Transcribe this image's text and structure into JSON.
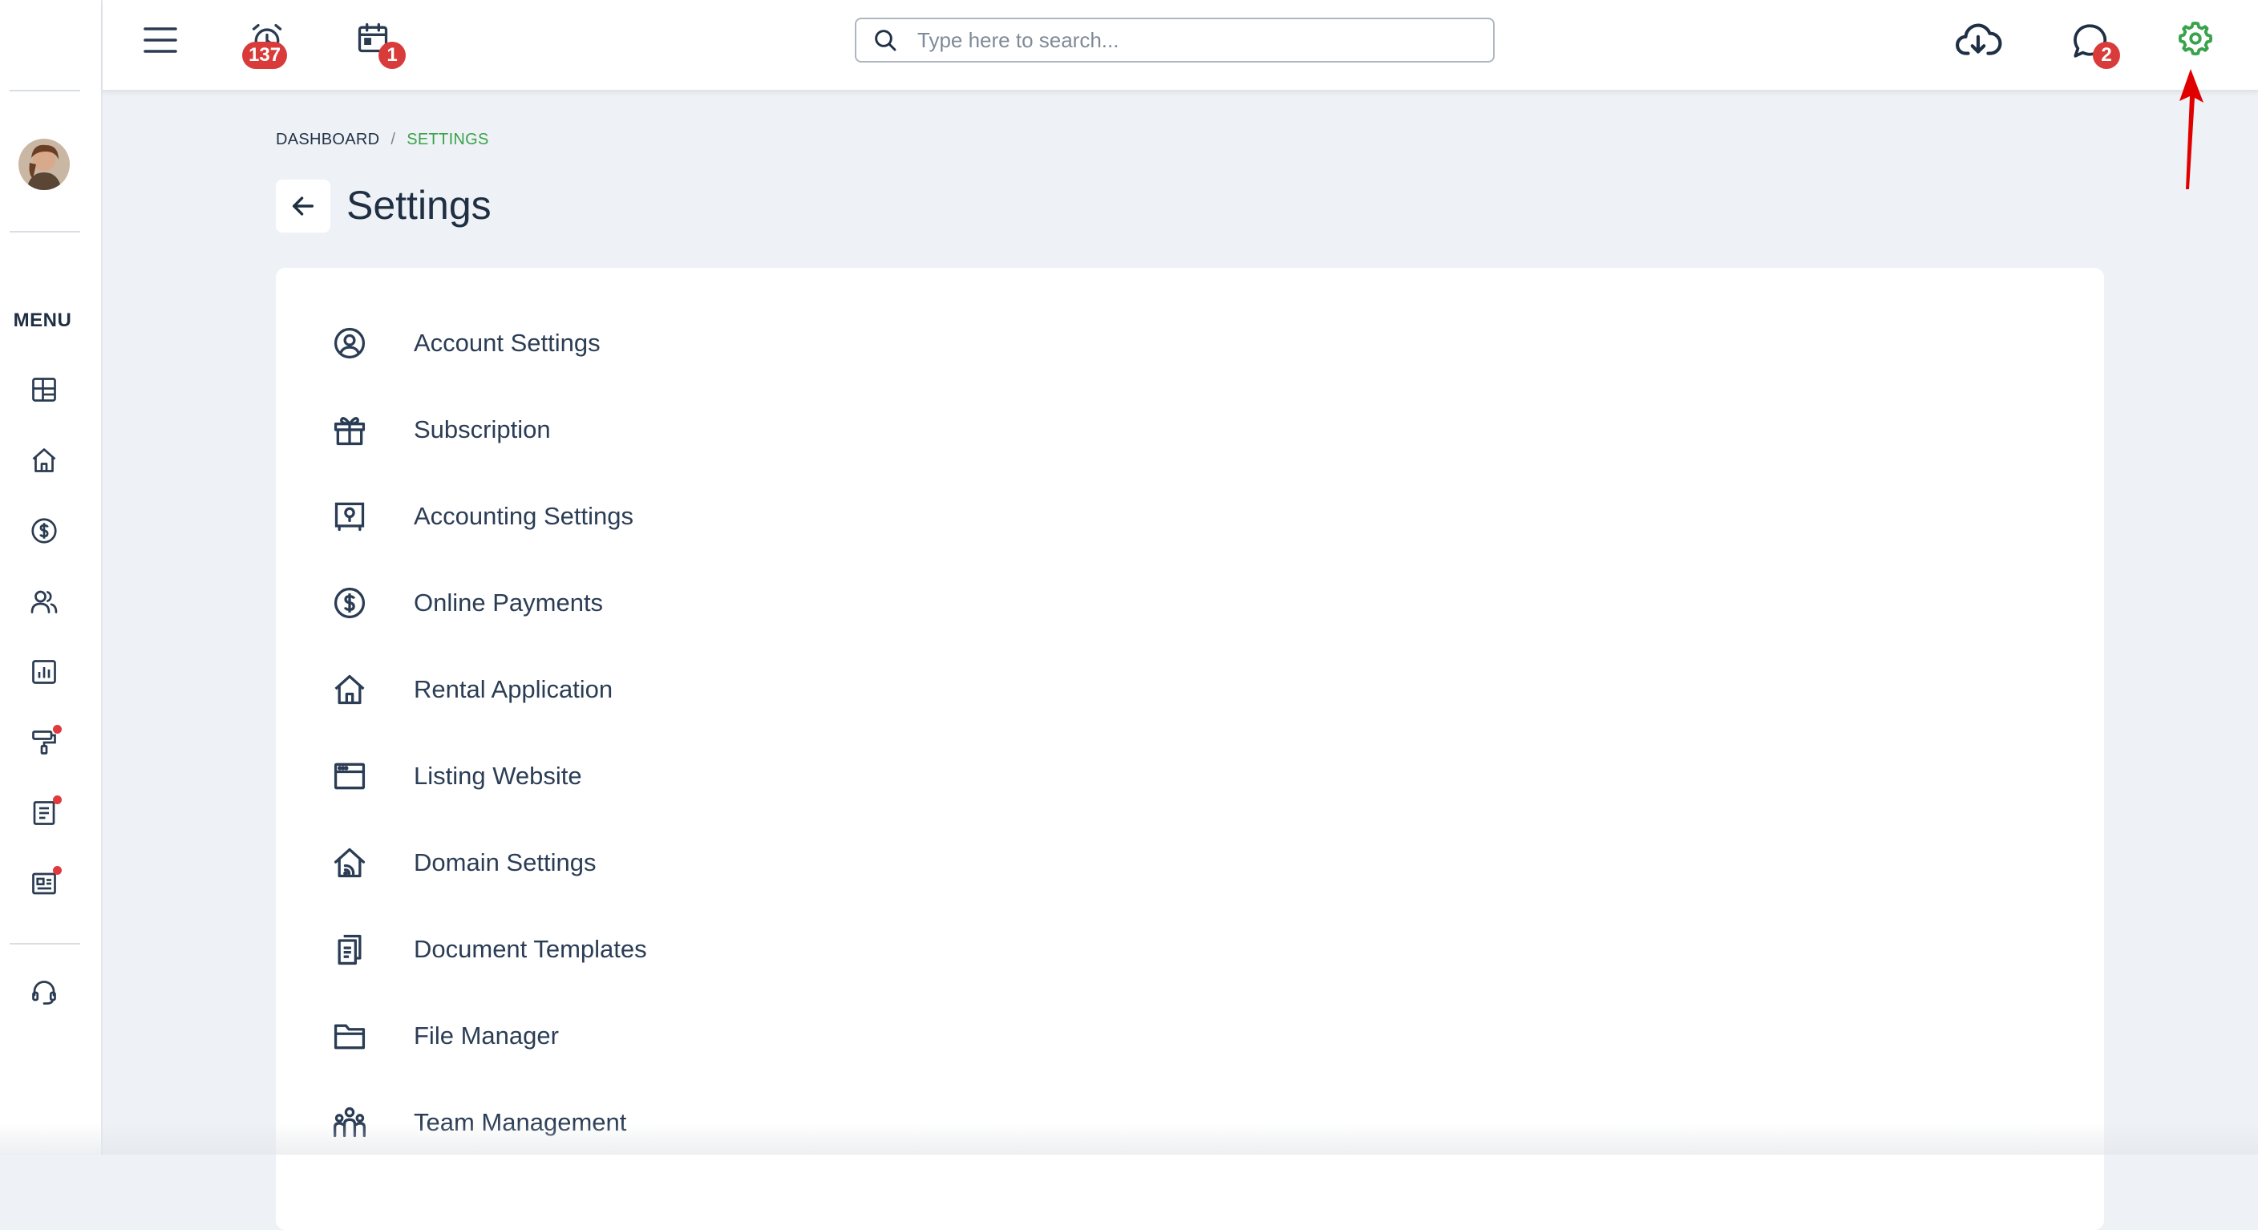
{
  "topbar": {
    "reminders_badge": "137",
    "calendar_badge": "1",
    "messages_badge": "2",
    "search_placeholder": "Type here to search..."
  },
  "sidebar": {
    "menu_label": "MENU"
  },
  "breadcrumb": {
    "root": "DASHBOARD",
    "separator": "/",
    "current": "SETTINGS"
  },
  "page": {
    "title": "Settings"
  },
  "settings": {
    "items": [
      {
        "label": "Account Settings",
        "icon": "user-circle-icon"
      },
      {
        "label": "Subscription",
        "icon": "gift-icon"
      },
      {
        "label": "Accounting Settings",
        "icon": "safe-icon"
      },
      {
        "label": "Online Payments",
        "icon": "dollar-circle-icon"
      },
      {
        "label": "Rental Application",
        "icon": "house-icon"
      },
      {
        "label": "Listing Website",
        "icon": "browser-window-icon"
      },
      {
        "label": "Domain Settings",
        "icon": "house-signal-icon"
      },
      {
        "label": "Document Templates",
        "icon": "documents-icon"
      },
      {
        "label": "File Manager",
        "icon": "folder-icon"
      },
      {
        "label": "Team Management",
        "icon": "team-icon"
      }
    ]
  },
  "colors": {
    "accent_green": "#38a34a",
    "badge_red": "#d93b3b",
    "annotation_red": "#e00000"
  }
}
